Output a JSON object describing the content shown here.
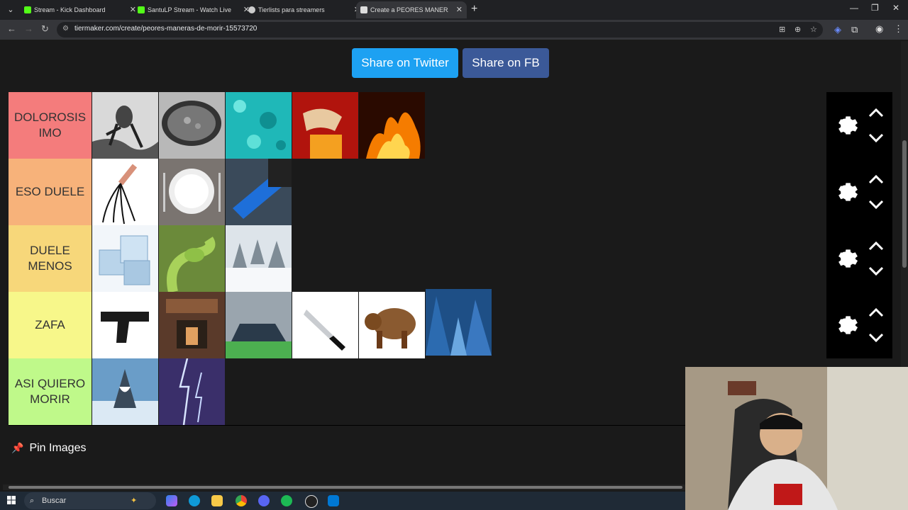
{
  "browser": {
    "tabs": [
      {
        "title": "Stream - Kick Dashboard",
        "favicon_color": "#53fc18",
        "active": false
      },
      {
        "title": "SantuLP Stream - Watch Live on Kick",
        "favicon_color": "#53fc18",
        "active": false
      },
      {
        "title": "Tierlists para streamers",
        "favicon_color": "#cccccc",
        "active": false
      },
      {
        "title": "Create a PEORES MANERAS DE MORIR Tier List",
        "favicon_color": "#dddddd",
        "active": true
      }
    ],
    "new_tab": "+",
    "url": "tiermaker.com/create/peores-maneras-de-morir-15573720"
  },
  "share": {
    "twitter_label": "Share on Twitter",
    "fb_label": "Share on FB"
  },
  "tiers": [
    {
      "label": "DOLOROSIS IMO",
      "color": "#f47c7c",
      "items": [
        "engraving-figure",
        "boiling-pot",
        "turquoise-water",
        "fire-chair",
        "flames"
      ]
    },
    {
      "label": "ESO DUELE",
      "color": "#f7b27a",
      "items": [
        "whip",
        "empty-plate",
        "blue-bottle"
      ]
    },
    {
      "label": "DUELE MENOS",
      "color": "#f7d77a",
      "items": [
        "ice-cubes",
        "green-snake",
        "snowy-forest"
      ]
    },
    {
      "label": "ZAFA",
      "color": "#f7f78a",
      "items": [
        "pistol",
        "elevator-shaft",
        "car-crash",
        "knife",
        "bear",
        "skyscrapers"
      ]
    },
    {
      "label": "ASI QUIERO MORIR",
      "color": "#bff98a",
      "items": [
        "shark",
        "lightning"
      ]
    }
  ],
  "pin_images_label": "Pin Images",
  "taskbar": {
    "search_label": "Buscar"
  }
}
